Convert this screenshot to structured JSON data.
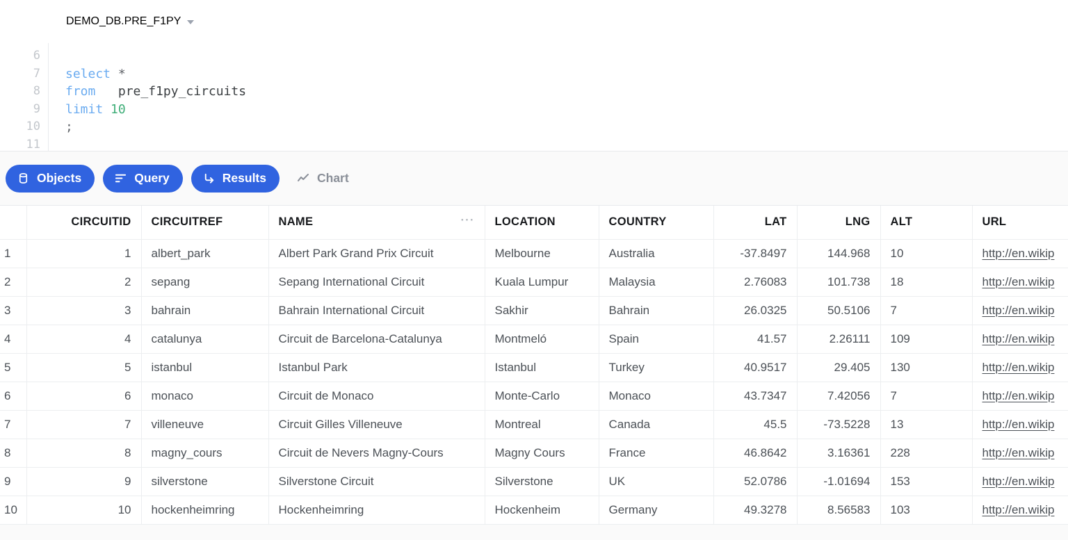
{
  "editor": {
    "database_selector": {
      "label": "DEMO_DB.PRE_F1PY",
      "caret_icon": "chevron-down-icon"
    },
    "line_numbers": [
      "6",
      "7",
      "8",
      "9",
      "10",
      "11"
    ],
    "sql_lines": [
      {
        "tokens": []
      },
      {
        "tokens": [
          {
            "t": "select",
            "c": "kw"
          },
          {
            "t": " ",
            "c": "punct"
          },
          {
            "t": "*",
            "c": "punct"
          }
        ]
      },
      {
        "tokens": [
          {
            "t": "from",
            "c": "kw"
          },
          {
            "t": "   ",
            "c": "punct"
          },
          {
            "t": "pre_f1py_circuits",
            "c": "ident"
          }
        ]
      },
      {
        "tokens": [
          {
            "t": "limit",
            "c": "kw"
          },
          {
            "t": " ",
            "c": "punct"
          },
          {
            "t": "10",
            "c": "num"
          }
        ]
      },
      {
        "tokens": [
          {
            "t": ";",
            "c": "punct"
          }
        ]
      },
      {
        "tokens": []
      }
    ],
    "sql_text": "select *\nfrom   pre_f1py_circuits\nlimit 10\n;"
  },
  "tabs": [
    {
      "label": "Objects",
      "icon": "database-icon",
      "active": true
    },
    {
      "label": "Query",
      "icon": "query-lines-icon",
      "active": true
    },
    {
      "label": "Results",
      "icon": "arrow-return-icon",
      "active": true
    },
    {
      "label": "Chart",
      "icon": "line-chart-icon",
      "active": false
    }
  ],
  "results": {
    "columns": [
      {
        "key": "circuitid",
        "label": "CIRCUITID",
        "align": "right"
      },
      {
        "key": "circuitref",
        "label": "CIRCUITREF",
        "align": "left"
      },
      {
        "key": "name",
        "label": "NAME",
        "align": "left",
        "menu_icon": "ellipsis-icon"
      },
      {
        "key": "location",
        "label": "LOCATION",
        "align": "left"
      },
      {
        "key": "country",
        "label": "COUNTRY",
        "align": "left"
      },
      {
        "key": "lat",
        "label": "LAT",
        "align": "right"
      },
      {
        "key": "lng",
        "label": "LNG",
        "align": "right"
      },
      {
        "key": "alt",
        "label": "ALT",
        "align": "left"
      },
      {
        "key": "url",
        "label": "URL",
        "align": "left"
      }
    ],
    "rows": [
      {
        "n": "1",
        "circuitid": "1",
        "circuitref": "albert_park",
        "name": "Albert Park Grand Prix Circuit",
        "location": "Melbourne",
        "country": "Australia",
        "lat": "-37.8497",
        "lng": "144.968",
        "alt": "10",
        "url": "http://en.wikip"
      },
      {
        "n": "2",
        "circuitid": "2",
        "circuitref": "sepang",
        "name": "Sepang International Circuit",
        "location": "Kuala Lumpur",
        "country": "Malaysia",
        "lat": "2.76083",
        "lng": "101.738",
        "alt": "18",
        "url": "http://en.wikip"
      },
      {
        "n": "3",
        "circuitid": "3",
        "circuitref": "bahrain",
        "name": "Bahrain International Circuit",
        "location": "Sakhir",
        "country": "Bahrain",
        "lat": "26.0325",
        "lng": "50.5106",
        "alt": "7",
        "url": "http://en.wikip"
      },
      {
        "n": "4",
        "circuitid": "4",
        "circuitref": "catalunya",
        "name": "Circuit de Barcelona-Catalunya",
        "location": "Montmeló",
        "country": "Spain",
        "lat": "41.57",
        "lng": "2.26111",
        "alt": "109",
        "url": "http://en.wikip"
      },
      {
        "n": "5",
        "circuitid": "5",
        "circuitref": "istanbul",
        "name": "Istanbul Park",
        "location": "Istanbul",
        "country": "Turkey",
        "lat": "40.9517",
        "lng": "29.405",
        "alt": "130",
        "url": "http://en.wikip"
      },
      {
        "n": "6",
        "circuitid": "6",
        "circuitref": "monaco",
        "name": "Circuit de Monaco",
        "location": "Monte-Carlo",
        "country": "Monaco",
        "lat": "43.7347",
        "lng": "7.42056",
        "alt": "7",
        "url": "http://en.wikip"
      },
      {
        "n": "7",
        "circuitid": "7",
        "circuitref": "villeneuve",
        "name": "Circuit Gilles Villeneuve",
        "location": "Montreal",
        "country": "Canada",
        "lat": "45.5",
        "lng": "-73.5228",
        "alt": "13",
        "url": "http://en.wikip"
      },
      {
        "n": "8",
        "circuitid": "8",
        "circuitref": "magny_cours",
        "name": "Circuit de Nevers Magny-Cours",
        "location": "Magny Cours",
        "country": "France",
        "lat": "46.8642",
        "lng": "3.16361",
        "alt": "228",
        "url": "http://en.wikip"
      },
      {
        "n": "9",
        "circuitid": "9",
        "circuitref": "silverstone",
        "name": "Silverstone Circuit",
        "location": "Silverstone",
        "country": "UK",
        "lat": "52.0786",
        "lng": "-1.01694",
        "alt": "153",
        "url": "http://en.wikip"
      },
      {
        "n": "10",
        "circuitid": "10",
        "circuitref": "hockenheimring",
        "name": "Hockenheimring",
        "location": "Hockenheim",
        "country": "Germany",
        "lat": "49.3278",
        "lng": "8.56583",
        "alt": "103",
        "url": "http://en.wikip"
      }
    ]
  },
  "colors": {
    "accent": "#3063e0",
    "keyword": "#6aabf0",
    "number": "#3fae78",
    "text": "#4b5056",
    "muted": "#9ca3af",
    "grid_line": "#eceef0",
    "panel_bg": "#fafafa"
  }
}
